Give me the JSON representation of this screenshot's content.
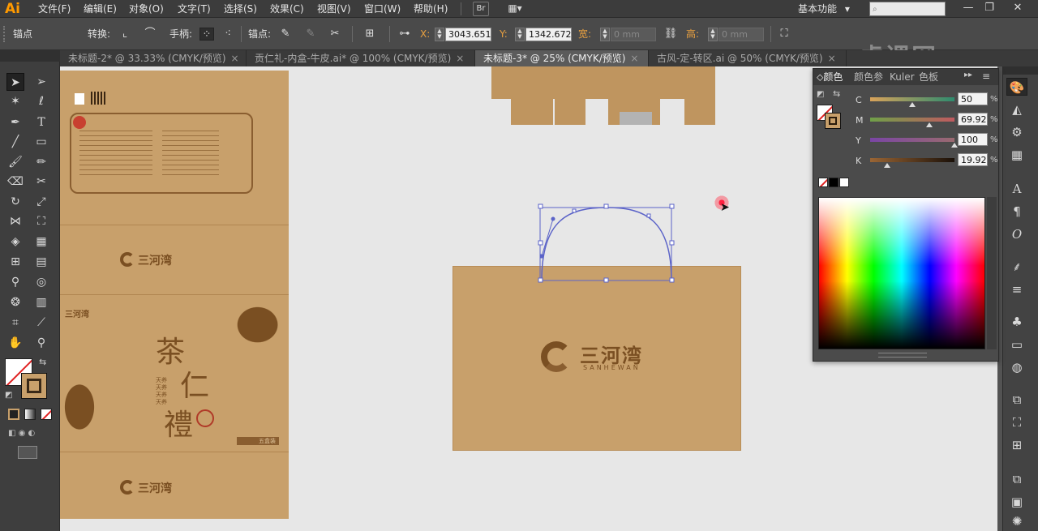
{
  "app": {
    "logo": "Ai",
    "menu": [
      "文件(F)",
      "编辑(E)",
      "对象(O)",
      "文字(T)",
      "选择(S)",
      "效果(C)",
      "视图(V)",
      "窗口(W)",
      "帮助(H)"
    ],
    "bridge_label": "Br",
    "workspace": "基本功能",
    "workspace_arrow": "▾",
    "window_buttons": [
      "—",
      "❐",
      "✕"
    ]
  },
  "controlbar": {
    "anchor_label": "锚点",
    "convert_label": "转换:",
    "handle_label": "手柄:",
    "anchor_point_label": "锚点:",
    "x_label": "X:",
    "x_value": "3043.651",
    "y_label": "Y:",
    "y_value": "1342.672",
    "width_label": "宽:",
    "width_value": "0 mm",
    "height_label": "高:",
    "height_value": "0 mm",
    "watermark": "虎课网"
  },
  "tabs": [
    {
      "label": "未标题-2* @ 33.33% (CMYK/预览)",
      "active": false
    },
    {
      "label": "贡仁礼-内盒-牛皮.ai* @ 100% (CMYK/预览)",
      "active": false
    },
    {
      "label": "未标题-3* @ 25% (CMYK/预览)",
      "active": true
    },
    {
      "label": "古风-定-转区.ai @ 50% (CMYK/预览)",
      "active": false
    }
  ],
  "tab_close": "×",
  "color_panel": {
    "tabs": [
      "颜色",
      "颜色参",
      "Kuler",
      "色板"
    ],
    "channels": [
      {
        "label": "C",
        "value": "50",
        "fraction": 0.5,
        "gradient": "linear-gradient(to right,#d9a35a,#2e8b6e)"
      },
      {
        "label": "M",
        "value": "69.92",
        "fraction": 0.6992,
        "gradient": "linear-gradient(to right,#6fa048,#c05a60)"
      },
      {
        "label": "Y",
        "value": "100",
        "fraction": 1.0,
        "gradient": "linear-gradient(to right,#7a45a5,#9a6a70)"
      },
      {
        "label": "K",
        "value": "19.92",
        "fraction": 0.1992,
        "gradient": "linear-gradient(to right,#9a6534,#1a1008)"
      }
    ],
    "percent": "%"
  },
  "artwork": {
    "brand_cn": "三河湾",
    "brand_en": "SANHEWAN",
    "tea_chars": [
      "茶",
      "仁",
      "禮"
    ],
    "badge_label": "五盒装",
    "bullets": [
      "天养",
      "天养",
      "天养",
      "天养"
    ]
  },
  "colors": {
    "kraft": "#c8a06b",
    "brand_brown": "#7a4f22",
    "selection_blue": "#5b63c8",
    "accent_orange": "#ff9a00"
  }
}
